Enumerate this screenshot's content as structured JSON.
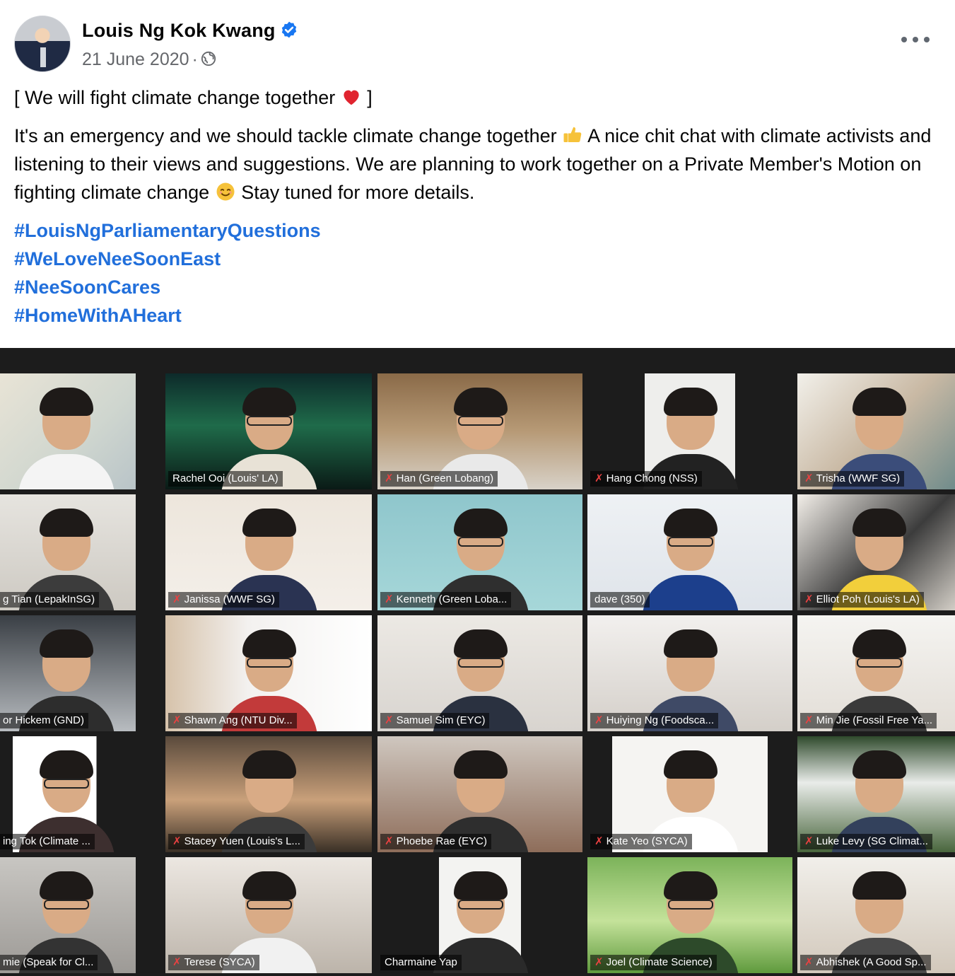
{
  "post": {
    "author": "Louis Ng Kok Kwang",
    "date": "21 June 2020",
    "separator": "·",
    "title_line": "[ We will fight climate change together",
    "title_end": "]",
    "body_part1": "It's an emergency and we should tackle climate change together",
    "body_part2": "A nice chit chat with climate activists and listening to their views and suggestions. We are planning to work together on a Private Member's Motion on fighting climate change",
    "body_part3": "Stay tuned for more details.",
    "hashtags": [
      "#LouisNgParliamentaryQuestions",
      "#WeLoveNeeSoonEast",
      "#NeeSoonCares",
      "#HomeWithAHeart"
    ]
  },
  "colors": {
    "hashtag": "#216fdb",
    "meta": "#65676b",
    "verified": "#1877f2",
    "active_speaker": "#cddc39"
  },
  "icons": [
    "verified-badge-icon",
    "globe-icon",
    "more-options-icon",
    "red-heart-emoji",
    "thumbs-up-emoji",
    "smiling-face-emoji",
    "muted-mic-icon"
  ],
  "video_call": {
    "participants": [
      {
        "name": "",
        "muted": false
      },
      {
        "name": "Rachel Ooi (Louis' LA)",
        "muted": false,
        "active": true
      },
      {
        "name": "Han (Green Lobang)",
        "muted": true
      },
      {
        "name": "Hang Chong (NSS)",
        "muted": true
      },
      {
        "name": "Trisha (WWF SG)",
        "muted": true
      },
      {
        "name": "g Tian (LepakInSG)",
        "muted": false
      },
      {
        "name": "Janissa (WWF SG)",
        "muted": true
      },
      {
        "name": "Kenneth (Green Loba...",
        "muted": true
      },
      {
        "name": "dave (350)",
        "muted": false
      },
      {
        "name": "Elliot Poh (Louis's LA)",
        "muted": true
      },
      {
        "name": "or Hickem (GND)",
        "muted": false
      },
      {
        "name": "Shawn Ang (NTU Div...",
        "muted": true
      },
      {
        "name": "Samuel Sim (EYC)",
        "muted": true
      },
      {
        "name": "Huiying Ng (Foodsca...",
        "muted": true
      },
      {
        "name": "Min Jie (Fossil Free Ya...",
        "muted": true
      },
      {
        "name": "ing Tok (Climate ...",
        "muted": false
      },
      {
        "name": "Stacey Yuen (Louis's L...",
        "muted": true
      },
      {
        "name": "Phoebe Rae (EYC)",
        "muted": true
      },
      {
        "name": "Kate Yeo (SYCA)",
        "muted": true
      },
      {
        "name": "Luke Levy (SG Climat...",
        "muted": true
      },
      {
        "name": "mie (Speak for Cl...",
        "muted": false
      },
      {
        "name": "Terese (SYCA)",
        "muted": true
      },
      {
        "name": "Charmaine Yap",
        "muted": false
      },
      {
        "name": "Joel (Climate Science)",
        "muted": true
      },
      {
        "name": "Abhishek (A Good Sp...",
        "muted": true
      }
    ]
  }
}
